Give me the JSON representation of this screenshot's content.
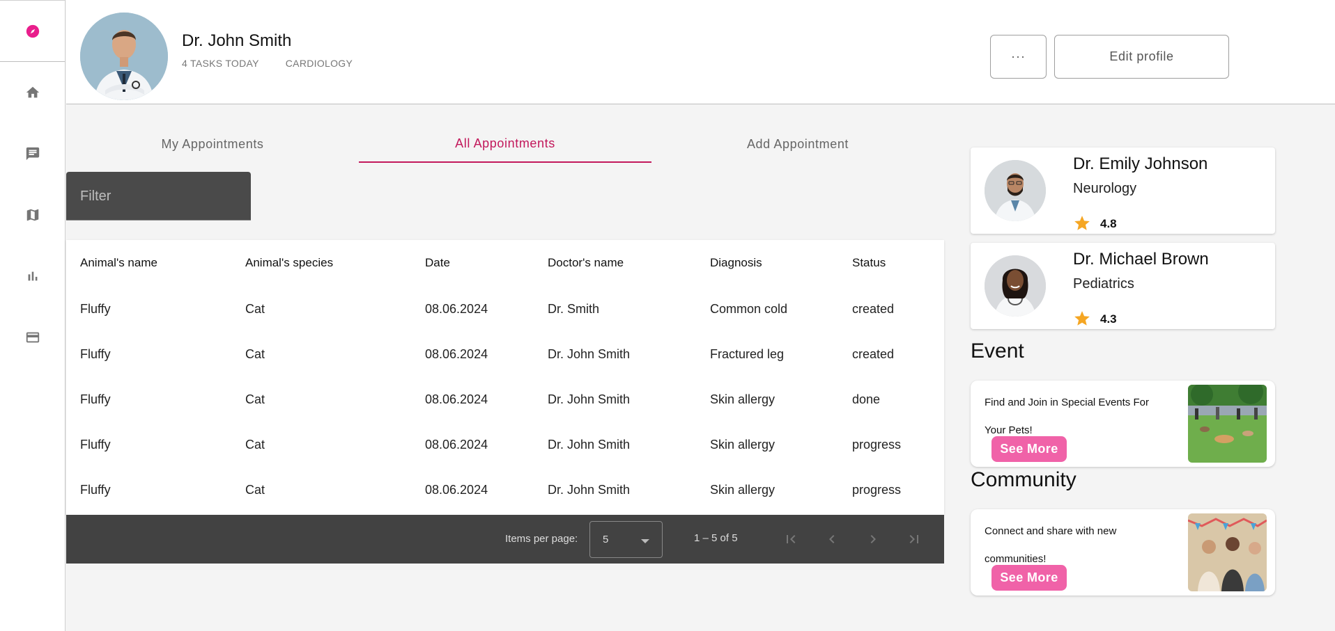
{
  "profile": {
    "name": "Dr. John Smith",
    "tasks": "4 TASKS TODAY",
    "department": "CARDIOLOGY",
    "more_label": "···",
    "edit_label": "Edit profile"
  },
  "tabs": [
    {
      "label": "My Appointments"
    },
    {
      "label": "All Appointments"
    },
    {
      "label": "Add Appointment"
    }
  ],
  "filter": {
    "placeholder": "Filter"
  },
  "table": {
    "headers": [
      "Animal's name",
      "Animal's species",
      "Date",
      "Doctor's name",
      "Diagnosis",
      "Status"
    ],
    "rows": [
      [
        "Fluffy",
        "Cat",
        "08.06.2024",
        "Dr. Smith",
        "Common cold",
        "created"
      ],
      [
        "Fluffy",
        "Cat",
        "08.06.2024",
        "Dr. John Smith",
        "Fractured leg",
        "created"
      ],
      [
        "Fluffy",
        "Cat",
        "08.06.2024",
        "Dr. John Smith",
        "Skin allergy",
        "done"
      ],
      [
        "Fluffy",
        "Cat",
        "08.06.2024",
        "Dr. John Smith",
        "Skin allergy",
        "progress"
      ],
      [
        "Fluffy",
        "Cat",
        "08.06.2024",
        "Dr. John Smith",
        "Skin allergy",
        "progress"
      ]
    ]
  },
  "paginator": {
    "items_label": "Items per page:",
    "page_size": "5",
    "range": "1 – 5 of 5"
  },
  "doctors": [
    {
      "name": "Dr. Emily Johnson",
      "specialty": "Neurology",
      "rating": "4.8"
    },
    {
      "name": "Dr. Michael Brown",
      "specialty": "Pediatrics",
      "rating": "4.3"
    }
  ],
  "event": {
    "title": "Event",
    "text": "Find and Join in Special Events For Your Pets!",
    "button": "See More"
  },
  "community": {
    "title": "Community",
    "text": "Connect and share with new communities!",
    "button": "See More"
  },
  "colors": {
    "accent": "#c2185b",
    "pink_button": "#f062a8",
    "star": "#f5a623",
    "dark_bar": "#424242"
  }
}
